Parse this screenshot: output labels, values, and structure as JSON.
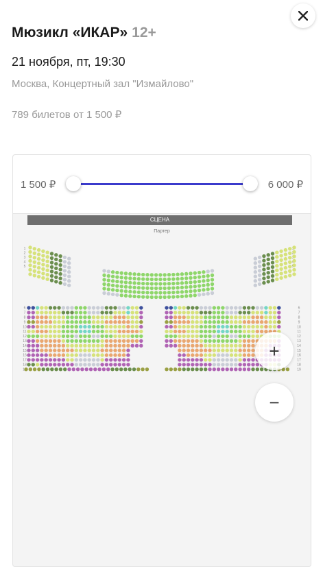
{
  "event": {
    "title": "Мюзикл «ИКАР»",
    "age": "12+",
    "datetime": "21 ноября, пт, 19:30",
    "venue": "Москва, Концертный зал \"Измайлово\"",
    "tickets": "789 билетов от 1 500 ₽"
  },
  "price_filter": {
    "min_label": "1 500 ₽",
    "max_label": "6 000 ₽",
    "selected_min_fraction": 0,
    "selected_max_fraction": 1,
    "track_color": "#3b3bcc"
  },
  "seat_map": {
    "stage_label": "СЦЕНА",
    "section_label": "Партер",
    "colors": {
      "unavailable": "#c9cdd6",
      "lime": "#d6e27a",
      "green": "#8ed66a",
      "olive": "#6b8e4e",
      "orange": "#e9a770",
      "purple": "#b064b4",
      "navy": "#3d4f9c",
      "teal": "#73d6c5",
      "khaki": "#9aa044"
    },
    "left_row_numbers": [
      "6",
      "7",
      "8",
      "9",
      "10",
      "11",
      "12",
      "13",
      "14",
      "15",
      "16",
      "17",
      "18",
      "19"
    ],
    "right_row_numbers": [
      "6",
      "7",
      "8",
      "9",
      "10",
      "11",
      "12",
      "13",
      "14",
      "15",
      "16",
      "17",
      "18",
      "19"
    ],
    "arc_row_numbers": [
      "1",
      "2",
      "3",
      "4",
      "5"
    ]
  },
  "controls": {
    "close_icon": "close-icon",
    "zoom_in_label": "+",
    "zoom_out_label": "−"
  }
}
